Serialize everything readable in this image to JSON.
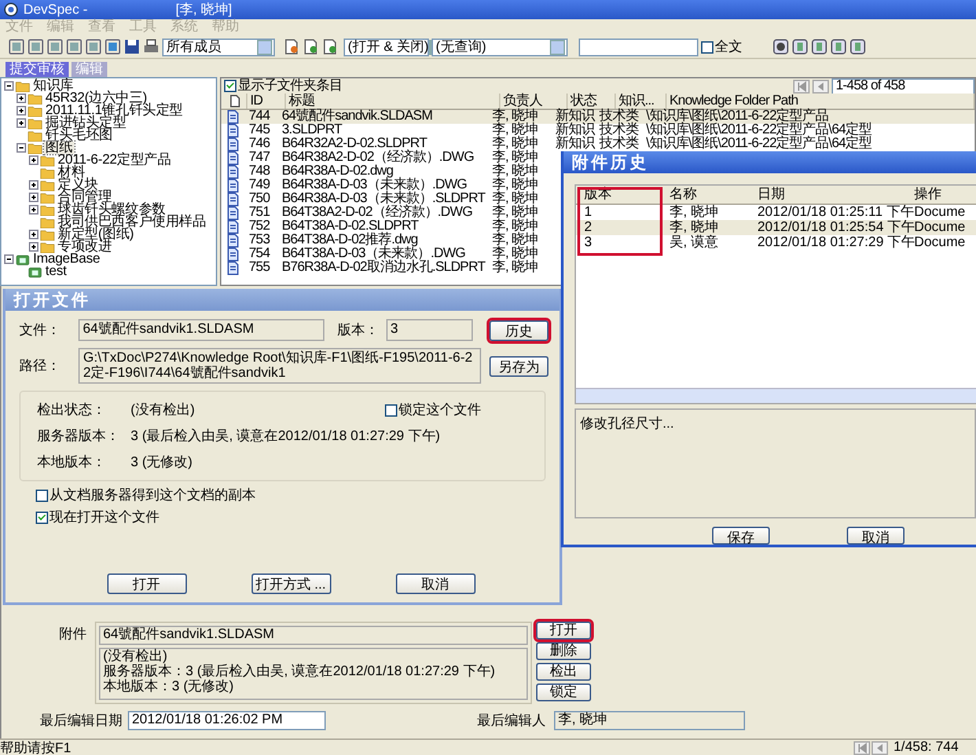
{
  "window": {
    "title": "DevSpec -",
    "user": "[李, 晓坤]"
  },
  "menu": [
    {
      "label": "文件",
      "disabled": true
    },
    {
      "label": "编辑",
      "disabled": true
    },
    {
      "label": "查看",
      "disabled": true
    },
    {
      "label": "工具",
      "disabled": true
    },
    {
      "label": "系统",
      "disabled": true
    },
    {
      "label": "帮助",
      "disabled": true
    }
  ],
  "toolbar": {
    "member_filter": "所有成员",
    "state_filter": "(打开 & 关闭)",
    "query_filter": "(无查询)",
    "fulltext": {
      "label": "全文",
      "checked": false
    }
  },
  "tabs": [
    {
      "label": "提交审核",
      "selected": true
    },
    {
      "label": "编辑",
      "selected": false
    }
  ],
  "tree": [
    {
      "label": "知识库",
      "kind": "folder",
      "expanded": true,
      "selected": false,
      "children": [
        {
          "label": "45R32(边六中三)",
          "kind": "folder",
          "expanded": false,
          "selected": false
        },
        {
          "label": "2011.11.1锥孔钎头定型",
          "kind": "folder",
          "expanded": false,
          "selected": false
        },
        {
          "label": "掘进钻头定型",
          "kind": "folder",
          "expanded": false,
          "selected": false
        },
        {
          "label": "钎头毛坯图",
          "kind": "folder",
          "selected": false
        },
        {
          "label": "图纸",
          "kind": "folder",
          "expanded": true,
          "selected": true,
          "children": [
            {
              "label": "2011-6-22定型产品",
              "kind": "folder",
              "expanded": false,
              "selected": false
            },
            {
              "label": "材料",
              "kind": "folder",
              "selected": false
            },
            {
              "label": "定义块",
              "kind": "folder",
              "expanded": false,
              "selected": false
            },
            {
              "label": "合同管理",
              "kind": "folder",
              "expanded": false,
              "selected": false
            },
            {
              "label": "球齿钎头螺纹参数",
              "kind": "folder",
              "expanded": false,
              "selected": false
            },
            {
              "label": "我司供巴西客户使用样品",
              "kind": "folder",
              "selected": false
            },
            {
              "label": "新定型(图纸)",
              "kind": "folder",
              "expanded": false,
              "selected": false
            },
            {
              "label": "专项改进",
              "kind": "folder",
              "expanded": false,
              "selected": false
            }
          ]
        }
      ]
    },
    {
      "label": "ImageBase",
      "kind": "library",
      "expanded": true,
      "selected": false,
      "children": [
        {
          "label": "test",
          "kind": "library",
          "selected": false
        }
      ]
    }
  ],
  "list": {
    "show_subfolders": {
      "label": "显示子文件夹条目",
      "checked": true
    },
    "pager": "1-458 of 458",
    "columns": [
      "ID",
      "标题",
      "负责人",
      "状态",
      "知识...",
      "Knowledge Folder Path"
    ],
    "rows": [
      {
        "id": "744",
        "title": "64號配件sandvik.SLDASM",
        "owner": "李, 晓坤",
        "status": "新知识",
        "category": "技术类",
        "path": "\\知识库\\图纸\\2011-6-22定型产品",
        "selected": true
      },
      {
        "id": "745",
        "title": "3.SLDPRT",
        "owner": "李, 晓坤",
        "status": "新知识",
        "category": "技术类",
        "path": "\\知识库\\图纸\\2011-6-22定型产品\\64定型",
        "selected": false
      },
      {
        "id": "746",
        "title": "B64R32A2-D-02.SLDPRT",
        "owner": "李, 晓坤",
        "status": "新知识",
        "category": "技术类",
        "path": "\\知识库\\图纸\\2011-6-22定型产品\\64定型",
        "selected": false
      },
      {
        "id": "747",
        "title": "B64R38A2-D-02（经济款）.DWG",
        "owner": "李, 晓坤",
        "selected": false
      },
      {
        "id": "748",
        "title": "B64R38A-D-02.dwg",
        "owner": "李, 晓坤",
        "selected": false
      },
      {
        "id": "749",
        "title": "B64R38A-D-03（未来款）.DWG",
        "owner": "李, 晓坤",
        "selected": false
      },
      {
        "id": "750",
        "title": "B64R38A-D-03（未来款）.SLDPRT",
        "owner": "李, 晓坤",
        "selected": false
      },
      {
        "id": "751",
        "title": "B64T38A2-D-02（经济款）.DWG",
        "owner": "李, 晓坤",
        "selected": false
      },
      {
        "id": "752",
        "title": "B64T38A-D-02.SLDPRT",
        "owner": "李, 晓坤",
        "selected": false
      },
      {
        "id": "753",
        "title": "B64T38A-D-02推荐.dwg",
        "owner": "李, 晓坤",
        "selected": false
      },
      {
        "id": "754",
        "title": "B64T38A-D-03（未来款）.DWG",
        "owner": "李, 晓坤",
        "selected": false
      },
      {
        "id": "755",
        "title": "B76R38A-D-02取消边水孔.SLDPRT",
        "owner": "李, 晓坤",
        "selected": false
      }
    ]
  },
  "open_dialog": {
    "title": "打开文件",
    "file_label": "文件：",
    "file": "64號配件sandvik1.SLDASM",
    "version_label": "版本：",
    "version": "3",
    "history_button": {
      "label": "历史",
      "marked": true
    },
    "path_label": "路径：",
    "path": "G:\\TxDoc\\P274\\Knowledge Root\\知识库-F1\\图纸-F195\\2011-6-22定-F196\\I744\\64號配件sandvik1",
    "save_as_button": "另存为",
    "status": [
      {
        "label": "检出状态：",
        "value": "(没有检出)"
      },
      {
        "label": "服务器版本：",
        "value": "3 (最后检入由吴, 谟意在2012/01/18 01:27:29 下午)"
      },
      {
        "label": "本地版本：",
        "value": "3 (无修改)"
      }
    ],
    "lock": {
      "label": "锁定这个文件",
      "checked": false
    },
    "options": [
      {
        "label": "从文档服务器得到这个文档的副本",
        "checked": false
      },
      {
        "label": "现在打开这个文件",
        "checked": true
      }
    ],
    "buttons": [
      "打开",
      "打开方式 ...",
      "取消"
    ]
  },
  "history_dialog": {
    "title": "附件历史",
    "columns": [
      "版本",
      "名称",
      "日期",
      "操作"
    ],
    "version_column_marked": true,
    "rows": [
      {
        "version": "1",
        "name": "李, 晓坤",
        "date": "2012/01/18 01:25:11 下午",
        "action": "Docume",
        "selected": false
      },
      {
        "version": "2",
        "name": "李, 晓坤",
        "date": "2012/01/18 01:25:54 下午",
        "action": "Docume",
        "selected": true
      },
      {
        "version": "3",
        "name": "吴, 谟意",
        "date": "2012/01/18 01:27:29 下午",
        "action": "Docume",
        "selected": false
      }
    ],
    "comment": "修改孔径尺寸...",
    "buttons": [
      "保存",
      "取消"
    ]
  },
  "details": {
    "attachment_label": "附件",
    "attachment": "64號配件sandvik1.SLDASM",
    "attachment_info": [
      "(没有检出)",
      "服务器版本：3 (最后检入由吴, 谟意在2012/01/18 01:27:29 下午)",
      "本地版本：3 (无修改)"
    ],
    "attachment_buttons": [
      {
        "label": "打开",
        "marked": true
      },
      {
        "label": "删除",
        "marked": false
      },
      {
        "label": "检出",
        "marked": false
      },
      {
        "label": "锁定",
        "marked": false
      }
    ],
    "last_edit_date_label": "最后编辑日期",
    "last_edit_date": "2012/01/18 01:26:02 PM",
    "last_editor_label": "最后编辑人",
    "last_editor": "李, 晓坤"
  },
  "status_bar": {
    "help": "帮助请按F1",
    "position": "1/458: 744"
  }
}
